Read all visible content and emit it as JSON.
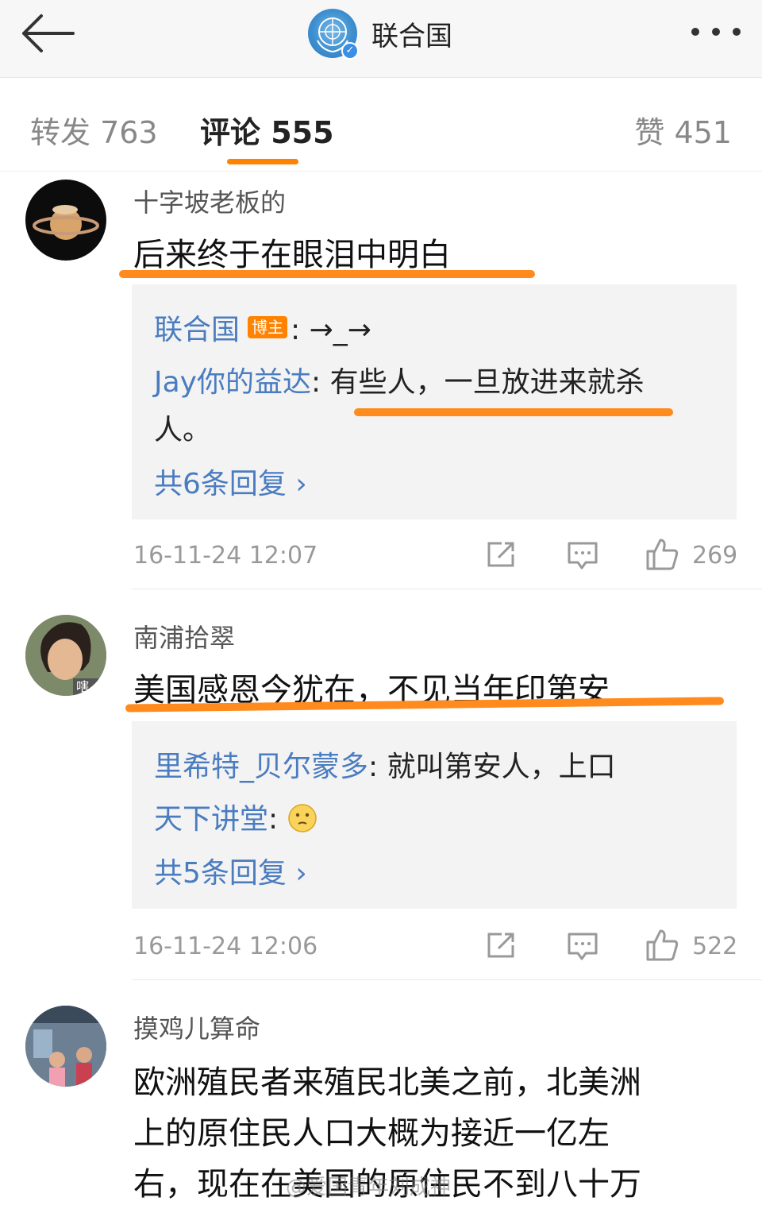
{
  "header": {
    "title": "联合国",
    "back_icon": "arrow-left-icon",
    "more_icon": "more-dots-icon"
  },
  "tabs": [
    {
      "label": "转发 763",
      "active": false
    },
    {
      "label": "评论 555",
      "active": true
    },
    {
      "label": "赞 451",
      "active": false
    }
  ],
  "comments": [
    {
      "user": "十字坡老板的",
      "text": "后来终于在眼泪中明白",
      "replies": [
        {
          "user": "联合国",
          "badge": "博主",
          "sep": ": ",
          "text": "→_→"
        },
        {
          "user": "Jay你的益达",
          "sep": ": ",
          "text": "有些人，一旦放进来就杀",
          "text2": "人。"
        }
      ],
      "more": "共6条回复 ›",
      "time": "16-11-24 12:07",
      "likes": "269"
    },
    {
      "user": "南浦拾翠",
      "text": "美国感恩今犹在，不见当年印第安",
      "replies": [
        {
          "user": "里希特_贝尔蒙多",
          "sep": ": ",
          "text": "就叫第安人，上口"
        },
        {
          "user": "天下讲堂",
          "sep": ": ",
          "text": ""
        }
      ],
      "more": "共5条回复 ›",
      "time": "16-11-24 12:06",
      "likes": "522"
    },
    {
      "user": "摸鸡儿算命",
      "lines": [
        "欧洲殖民者来殖民北美之前，北美洲",
        "上的原住民人口大概为接近一亿左",
        "右，现在在美国的原住民不到八十万"
      ]
    }
  ],
  "watermark": "@爱国青年刘成神",
  "colors": {
    "accent": "#ff8200",
    "link": "#4a7cc0",
    "underline": "#ff8a1e"
  }
}
